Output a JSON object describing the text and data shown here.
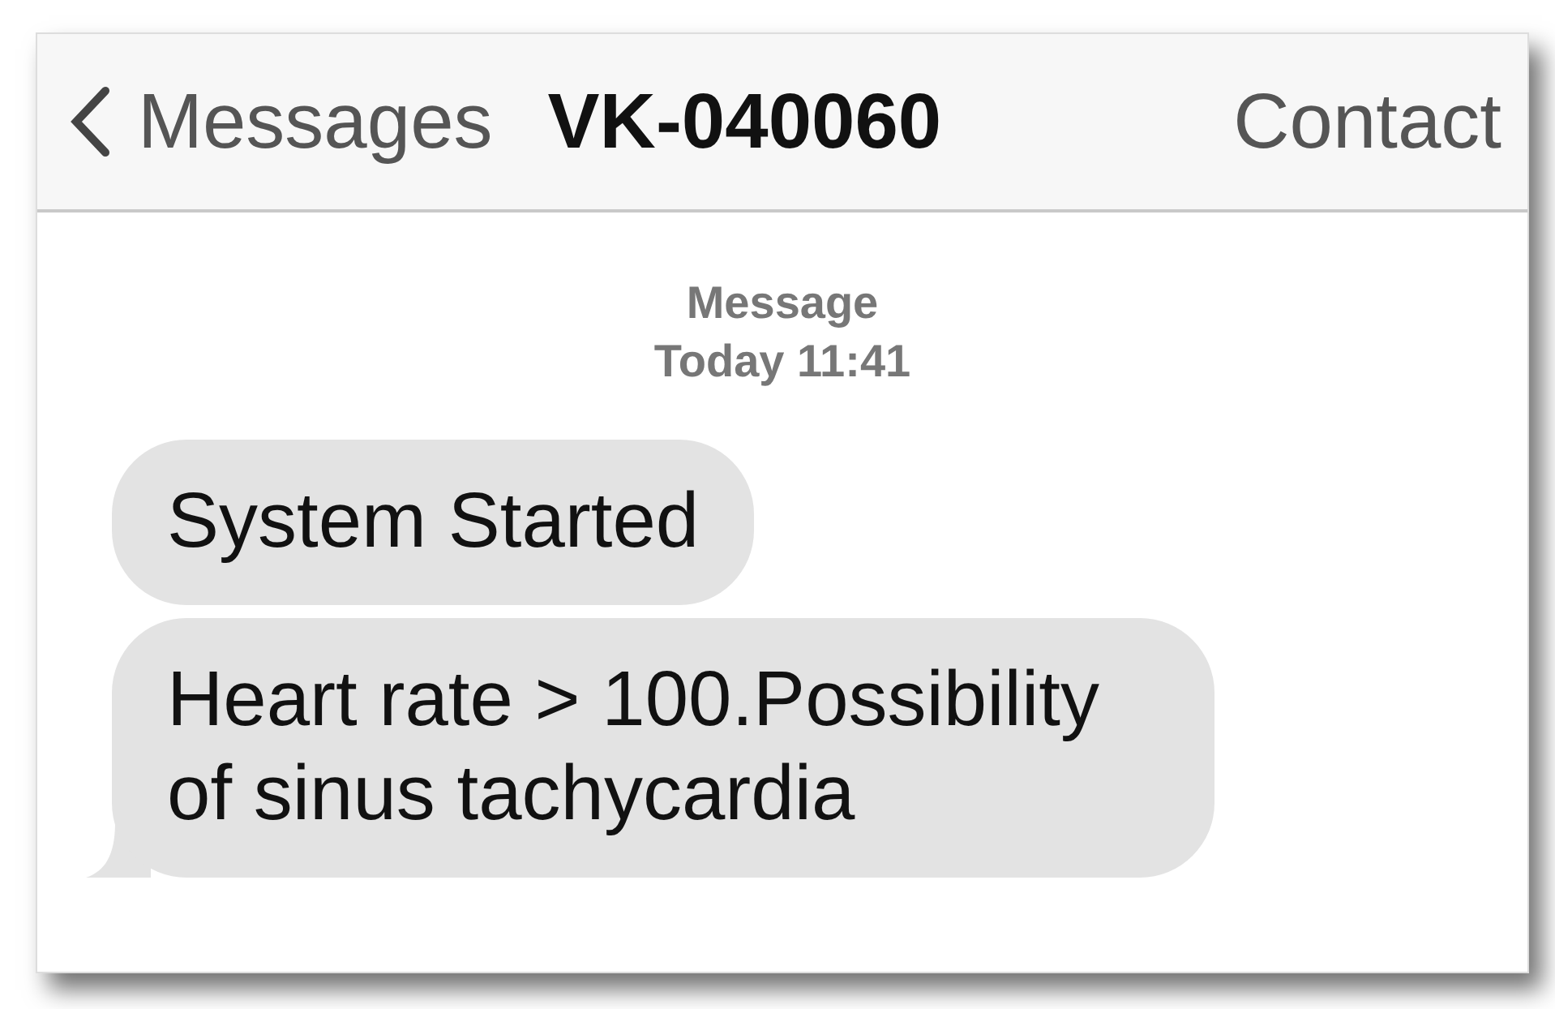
{
  "nav_bar": {
    "back_label": "Messages",
    "title": "VK-040060",
    "action": "Contact"
  },
  "timestamp": {
    "label": "Message",
    "time": "Today 11:41"
  },
  "messages": [
    {
      "text": "System Started",
      "tail": false
    },
    {
      "text": "Heart rate > 100.Possibility of sinus tachycardia",
      "tail": true
    }
  ]
}
